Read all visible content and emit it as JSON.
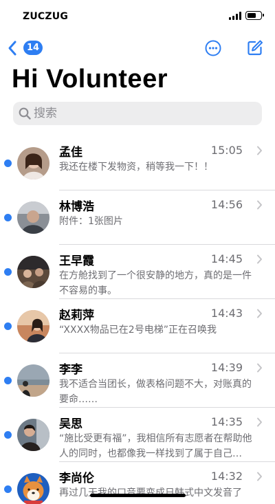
{
  "status_bar": {
    "carrier": "ZUCZUG",
    "battery_level": 0.7
  },
  "nav": {
    "back_badge": "14"
  },
  "page_title": "Hi Volunteer",
  "search": {
    "placeholder": "搜索"
  },
  "colors": {
    "accent": "#2e7ef2",
    "secondary_text": "#6d6d72",
    "search_bg": "#ededee"
  },
  "conversations": [
    {
      "name": "孟佳",
      "time": "15:05",
      "preview": "我还在楼下发物资，稍等我一下！！",
      "unread": true,
      "avatar": "avatar-photo"
    },
    {
      "name": "林博浩",
      "time": "14:56",
      "preview": "附件：1张图片",
      "unread": true,
      "avatar": "avatar-photo"
    },
    {
      "name": "王早霞",
      "time": "14:45",
      "preview": "在方舱找到了一个很安静的地方，真的是一件不容易的事。",
      "unread": true,
      "avatar": "avatar-photo"
    },
    {
      "name": "赵莉萍",
      "time": "14:43",
      "preview": "“XXXX物品已在2号电梯”正在召唤我",
      "unread": true,
      "avatar": "avatar-photo"
    },
    {
      "name": "李李",
      "time": "14:39",
      "preview": "我不适合当团长，做表格问题不大，对账真的要命……",
      "unread": true,
      "avatar": "avatar-photo"
    },
    {
      "name": "吴思",
      "time": "14:35",
      "preview": "“施比受更有福”，我相信所有志愿者在帮助他人的同时，也都像我一样找到了属于自己…",
      "unread": true,
      "avatar": "avatar-photo"
    },
    {
      "name": "李尚伦",
      "time": "14:32",
      "preview": "再过几天我的口音要变成日韩式中文发音了",
      "unread": true,
      "avatar": "avatar-shiba-illustration"
    }
  ]
}
